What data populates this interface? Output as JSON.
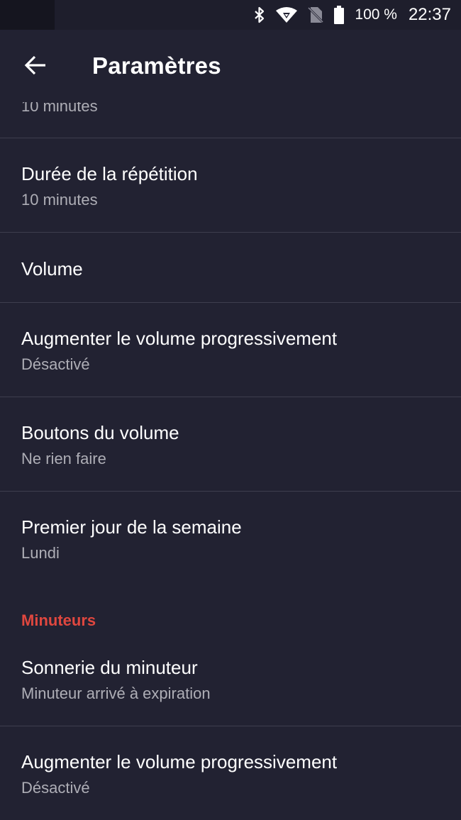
{
  "status_bar": {
    "battery_percent": "100 %",
    "time": "22:37",
    "icons": [
      "bluetooth-icon",
      "wifi-icon",
      "no-sim-icon",
      "battery-icon"
    ]
  },
  "app_bar": {
    "back_icon": "arrow-left-icon",
    "title": "Paramètres"
  },
  "settings": {
    "partial_subtitle": "10 minutes",
    "snooze": {
      "title": "Durée de la répétition",
      "value": "10 minutes"
    },
    "volume": {
      "title": "Volume"
    },
    "alarm_crescendo": {
      "title": "Augmenter le volume progressivement",
      "value": "Désactivé"
    },
    "volume_buttons": {
      "title": "Boutons du volume",
      "value": "Ne rien faire"
    },
    "week_start": {
      "title": "Premier jour de la semaine",
      "value": "Lundi"
    }
  },
  "timers_section": {
    "header": "Minuteurs",
    "timer_ringtone": {
      "title": "Sonnerie du minuteur",
      "value": "Minuteur arrivé à expiration"
    },
    "timer_crescendo": {
      "title": "Augmenter le volume progressivement",
      "value": "Désactivé"
    }
  },
  "colors": {
    "background": "#222232",
    "accent": "#e0473f",
    "divider": "#3e3e4e",
    "secondary_text": "#aeaeb6"
  }
}
